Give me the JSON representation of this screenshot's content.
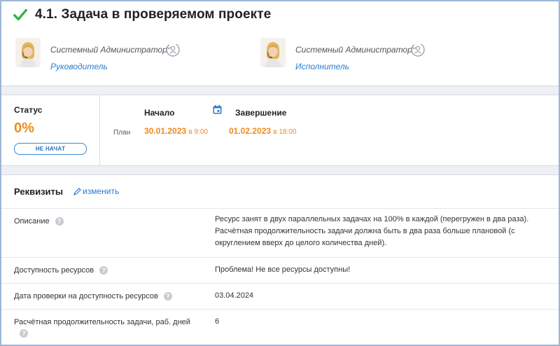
{
  "task": {
    "title": "4.1. Задача в проверяемом проекте"
  },
  "people": [
    {
      "name": "Системный Администратор",
      "role": "Руководитель"
    },
    {
      "name": "Системный Администратор",
      "role": "Исполнитель"
    }
  ],
  "status": {
    "label": "Статус",
    "percent": "0%",
    "badge": "НЕ НАЧАТ"
  },
  "schedule": {
    "start_label": "Начало",
    "end_label": "Завершение",
    "plan_label": "План",
    "start_date": "30.01.2023",
    "start_time": "в 9:00",
    "end_date": "01.02.2023",
    "end_time": "в 18:00"
  },
  "requisites": {
    "title": "Реквизиты",
    "edit_label": "изменить",
    "rows": [
      {
        "label": "Описание",
        "value": "Ресурс занят в двух параллельных задачах на 100% в каждой (перегружен в два раза). Расчётная продолжительность задачи должна быть в два раза больше плановой (с округлением вверх до целого количества дней)."
      },
      {
        "label": "Доступность ресурсов",
        "value": "Проблема! Не все ресурсы доступны!"
      },
      {
        "label": "Дата проверки на доступность ресурсов",
        "value": "03.04.2024"
      },
      {
        "label": "Расчётная продолжительность задачи, раб. дней",
        "value": "6"
      }
    ]
  },
  "colors": {
    "accent_orange": "#f08a1c",
    "link_blue": "#2a7bd1",
    "check_green": "#2bb34a"
  },
  "icons": {
    "title": "check-icon",
    "reassign": "reassign-user-icon",
    "calendar": "calendar-icon",
    "edit": "pencil-icon",
    "help": "question-icon"
  }
}
